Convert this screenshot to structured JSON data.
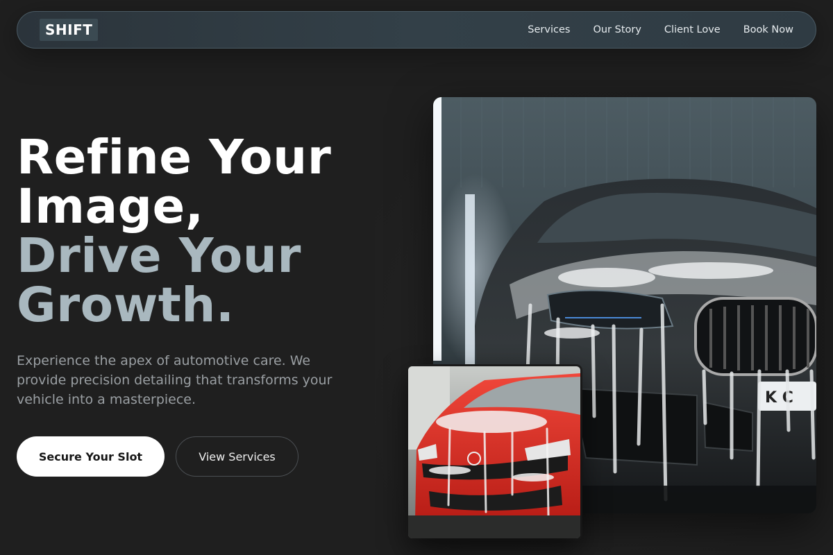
{
  "brand": {
    "logo": "SHIFT"
  },
  "nav": {
    "links": [
      "Services",
      "Our Story",
      "Client Love",
      "Book Now"
    ]
  },
  "hero": {
    "title_line1": "Refine Your Image,",
    "title_line2": "Drive Your Growth.",
    "subtitle": "Experience the apex of automotive care. We provide precision detailing that transforms your vehicle into a masterpiece.",
    "primary_cta": "Secure Your Slot",
    "secondary_cta": "View Services"
  },
  "images": {
    "main": "dark luxury car covered in wash foam",
    "inset": "red car covered in wash foam",
    "plate_text": "K C"
  },
  "colors": {
    "background": "#1f1f1f",
    "nav_bg": "#303b42",
    "accent_text": "#a9b8bf",
    "primary_button": "#ffffff"
  }
}
